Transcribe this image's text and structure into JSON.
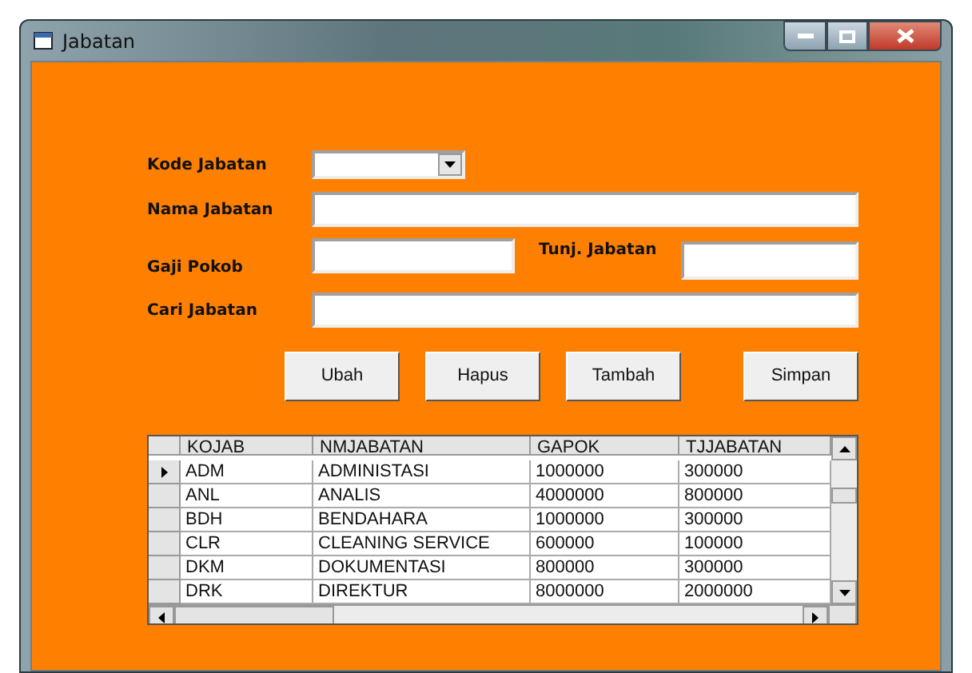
{
  "window": {
    "title": "Jabatan"
  },
  "form": {
    "kode_label": "Kode Jabatan",
    "nama_label": "Nama Jabatan",
    "gaji_label": "Gaji Pokob",
    "tunj_label": "Tunj. Jabatan",
    "cari_label": "Cari Jabatan"
  },
  "buttons": [
    "Ubah",
    "Hapus",
    "Tambah",
    "Simpan"
  ],
  "table": {
    "columns": [
      "KOJAB",
      "NMJABATAN",
      "GAPOK",
      "TJJABATAN"
    ],
    "rows": [
      {
        "cells": [
          "ADM",
          "ADMINISTASI",
          "1000000",
          "300000"
        ],
        "selected": true
      },
      {
        "cells": [
          "ANL",
          "ANALIS",
          "4000000",
          "800000"
        ],
        "selected": false
      },
      {
        "cells": [
          "BDH",
          "BENDAHARA",
          "1000000",
          "300000"
        ],
        "selected": false
      },
      {
        "cells": [
          "CLR",
          "CLEANING SERVICE",
          "600000",
          "100000"
        ],
        "selected": false
      },
      {
        "cells": [
          "DKM",
          "DOKUMENTASI",
          "800000",
          "300000"
        ],
        "selected": false
      },
      {
        "cells": [
          "DRK",
          "DIREKTUR",
          "8000000",
          "2000000"
        ],
        "selected": false
      }
    ]
  }
}
